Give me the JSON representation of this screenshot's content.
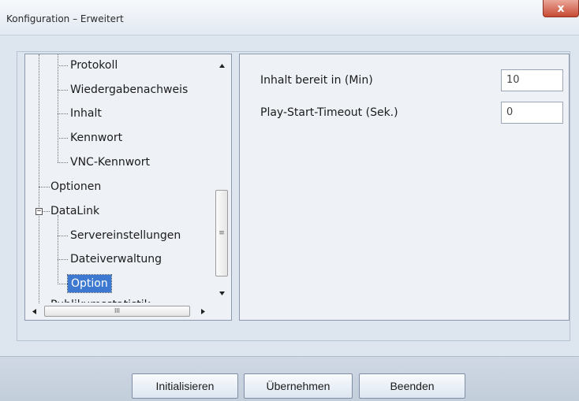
{
  "window": {
    "title": "Konfiguration – Erweitert",
    "close_glyph": "x"
  },
  "tree": {
    "items": [
      {
        "label": "Protokoll"
      },
      {
        "label": "Wiedergabenachweis"
      },
      {
        "label": "Inhalt"
      },
      {
        "label": "Kennwort"
      },
      {
        "label": "VNC-Kennwort"
      },
      {
        "label": "Optionen"
      },
      {
        "label": "DataLink",
        "expander": "−"
      },
      {
        "label": "Servereinstellungen"
      },
      {
        "label": "Dateiverwaltung"
      },
      {
        "label": "Option",
        "selected": true
      },
      {
        "label": "Publikumsstatistik"
      }
    ],
    "scroll_thumb_glyph": "≡",
    "hscroll_thumb_glyph": "III"
  },
  "settings": {
    "fields": [
      {
        "label": "Inhalt bereit in (Min)",
        "value": "10"
      },
      {
        "label": "Play-Start-Timeout (Sek.)",
        "value": "0"
      }
    ]
  },
  "footer": {
    "initialize_label": "Initialisieren",
    "apply_label": "Übernehmen",
    "exit_label": "Beenden"
  },
  "colors": {
    "selection": "#3d79d1",
    "background": "#dde5ef",
    "close_button": "#c84a33"
  }
}
